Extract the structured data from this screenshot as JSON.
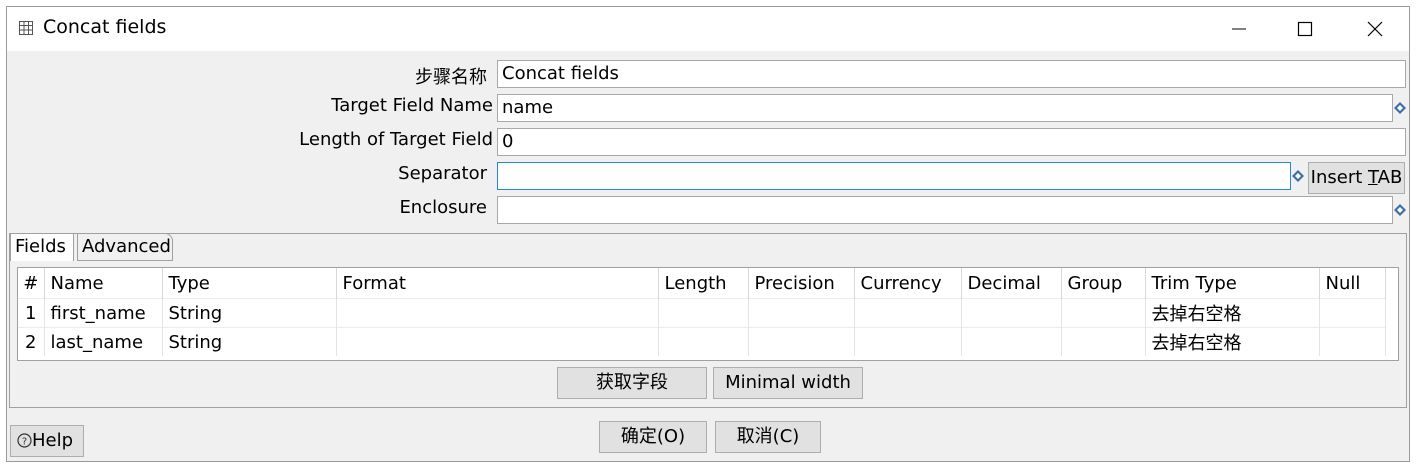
{
  "window": {
    "title": "Concat fields",
    "icons": {
      "app": "table-icon",
      "minimize": "minimize-icon",
      "maximize": "maximize-icon",
      "close": "close-icon"
    }
  },
  "form": {
    "step_name_label": "步骤名称",
    "step_name_value": "Concat fields",
    "target_field_label": "Target Field Name",
    "target_field_value": "name",
    "length_label": "Length of Target Field",
    "length_value": "0",
    "separator_label": "Separator",
    "separator_value": "",
    "insert_tab_prefix": "Insert ",
    "insert_tab_key": "T",
    "insert_tab_suffix": "AB",
    "enclosure_label": "Enclosure",
    "enclosure_value": ""
  },
  "tabs": [
    {
      "label": "Fields",
      "active": true
    },
    {
      "label": "Advanced",
      "active": false
    }
  ],
  "grid": {
    "columns": [
      "#",
      "Name",
      "Type",
      "Format",
      "Length",
      "Precision",
      "Currency",
      "Decimal",
      "Group",
      "Trim Type",
      "Null"
    ],
    "rows": [
      [
        "1",
        "first_name",
        "String",
        "",
        "",
        "",
        "",
        "",
        "",
        "去掉右空格",
        ""
      ],
      [
        "2",
        "last_name",
        "String",
        "",
        "",
        "",
        "",
        "",
        "",
        "去掉右空格",
        ""
      ]
    ]
  },
  "buttons": {
    "get_fields": "获取字段",
    "minimal_width": "Minimal width",
    "ok": "确定(O)",
    "cancel": "取消(C)",
    "help": "Help"
  },
  "colors": {
    "focus_border": "#2a86d6",
    "variable_icon": "#3b6ea5"
  }
}
